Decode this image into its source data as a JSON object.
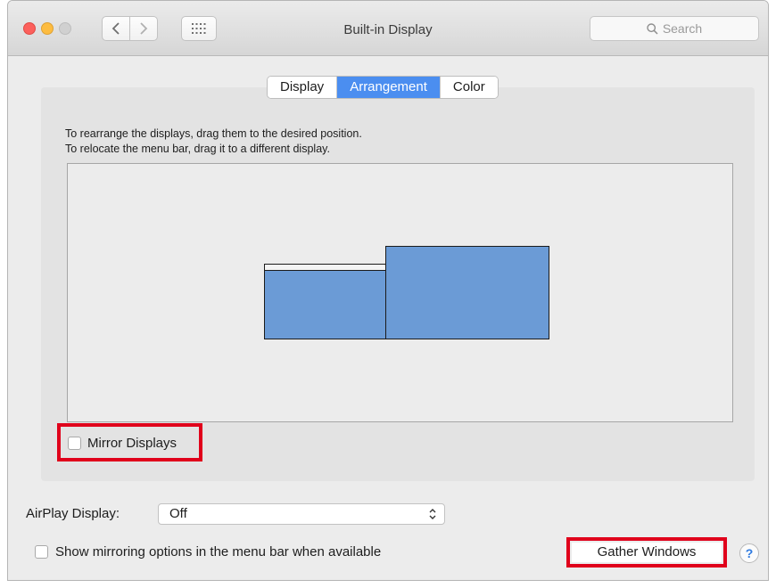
{
  "window": {
    "title": "Built-in Display",
    "search_placeholder": "Search"
  },
  "tabs": [
    {
      "label": "Display",
      "active": false
    },
    {
      "label": "Arrangement",
      "active": true
    },
    {
      "label": "Color",
      "active": false
    }
  ],
  "arrangement": {
    "instruction_line1": "To rearrange the displays, drag them to the desired position.",
    "instruction_line2": "To relocate the menu bar, drag it to a different display.",
    "mirror_label": "Mirror Displays",
    "mirror_checked": false
  },
  "airplay": {
    "label": "AirPlay Display:",
    "selected": "Off"
  },
  "show_mirroring": {
    "label": "Show mirroring options in the menu bar when available",
    "checked": false
  },
  "buttons": {
    "gather": "Gather Windows",
    "help": "?"
  },
  "colors": {
    "accent": "#4b8ef0",
    "display_fill": "#6b9bd6",
    "highlight": "#e0001b"
  }
}
